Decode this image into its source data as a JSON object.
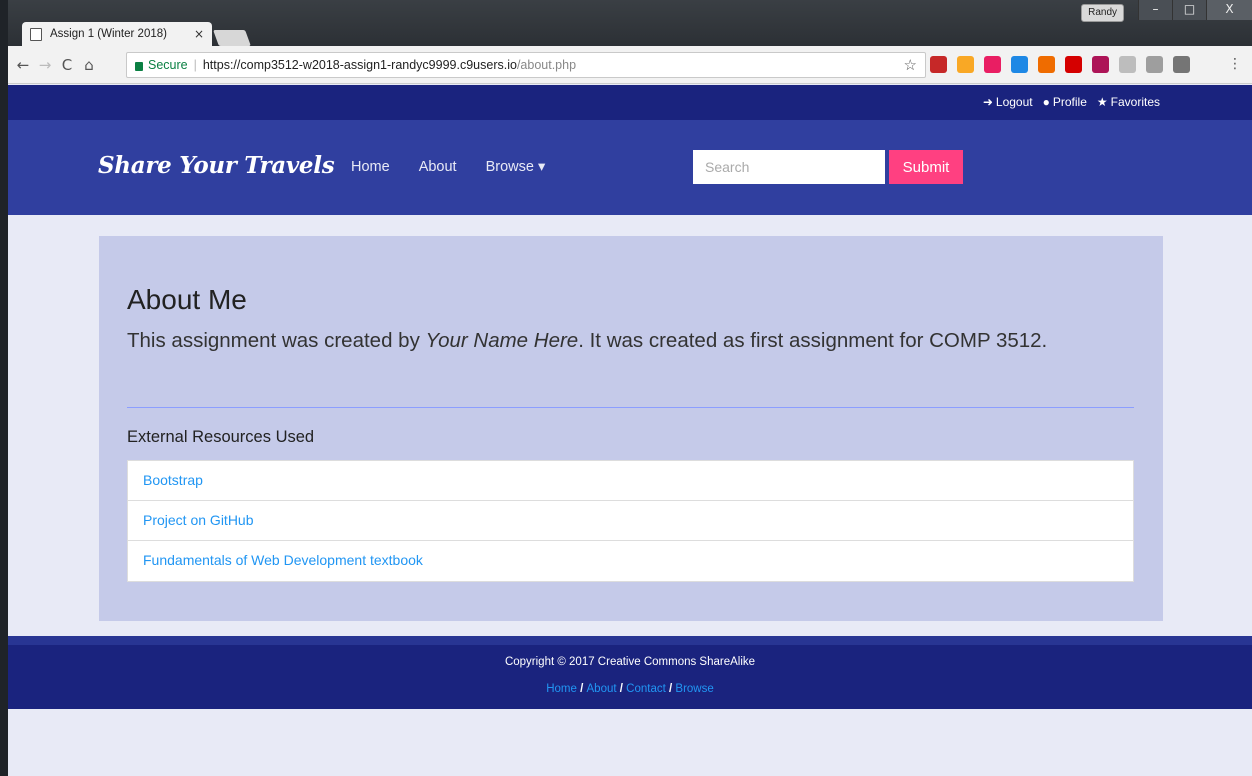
{
  "browser": {
    "tab_title": "Assign 1 (Winter 2018)",
    "tab_close": "×",
    "profile_name": "Randy",
    "window_buttons": [
      "–",
      "□",
      "X"
    ],
    "nav_buttons": [
      "←",
      "→",
      "C",
      "⌂"
    ],
    "secure_label": "Secure",
    "url_main": "https://comp3512-w2018-assign1-randyc9999.c9users.io",
    "url_path": "/about.php",
    "star": "☆",
    "menu": "⋮",
    "extension_colors": [
      "#c62828",
      "#f9a825",
      "#e91e63",
      "#1e88e5",
      "#ef6c00",
      "#d50000",
      "#ad1457",
      "#bdbdbd",
      "#9e9e9e",
      "#757575"
    ]
  },
  "topbar": {
    "logout": "Logout",
    "profile": "Profile",
    "favorites": "Favorites"
  },
  "header": {
    "brand": "Share Your Travels",
    "nav": [
      "Home",
      "About",
      "Browse ▾"
    ],
    "search_placeholder": "Search",
    "submit_label": "Submit"
  },
  "about": {
    "title": "About Me",
    "text_before": "This assignment was created by ",
    "name": "Your Name Here",
    "text_after": ". It was created as first assignment for COMP 3512.",
    "resources_heading": "External Resources Used",
    "resources": [
      "Bootstrap",
      "Project on GitHub",
      "Fundamentals of Web Development textbook"
    ]
  },
  "footer": {
    "copyright": "Copyright © 2017 Creative Commons ShareAlike",
    "links": [
      "Home",
      "About",
      "Contact",
      "Browse"
    ],
    "separator": " / "
  },
  "colors": {
    "topbar": "#1a237e",
    "header": "#303f9f",
    "panel": "#c5cae9",
    "accent": "#ff4081",
    "link": "#2196f3"
  }
}
